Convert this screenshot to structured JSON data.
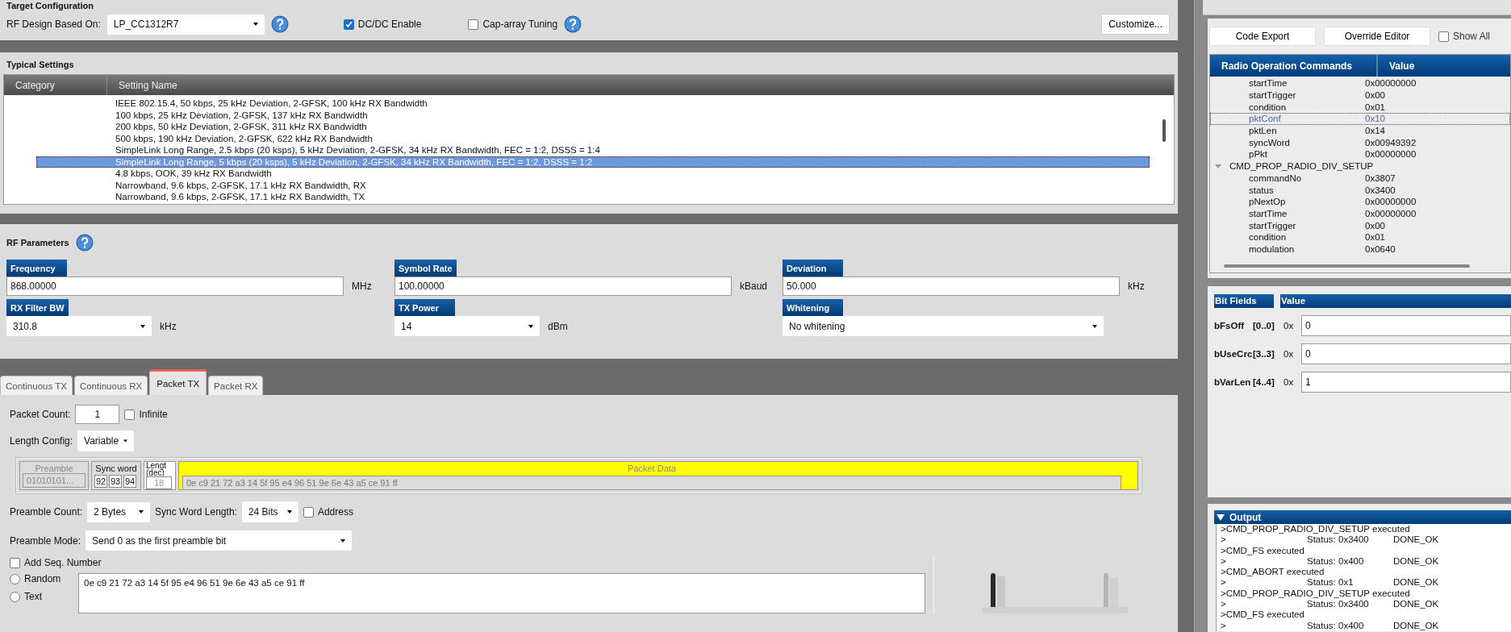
{
  "target_config": {
    "title": "Target Configuration",
    "rf_design_label": "RF Design Based On:",
    "rf_design_value": "LP_CC1312R7",
    "dcdc": {
      "label": "DC/DC Enable",
      "checked": true
    },
    "cap_array": {
      "label": "Cap-array Tuning",
      "checked": false
    },
    "customize_button": "Customize..."
  },
  "typical_settings": {
    "title": "Typical Settings",
    "columns": [
      "Category",
      "Setting Name"
    ],
    "rows": [
      {
        "name": "IEEE 802.15.4, 50 kbps, 25 kHz Deviation, 2-GFSK, 100 kHz RX Bandwidth",
        "selected": false
      },
      {
        "name": "100 kbps, 25 kHz Deviation, 2-GFSK, 137 kHz RX Bandwidth",
        "selected": false
      },
      {
        "name": "200 kbps, 50 kHz Deviation, 2-GFSK, 311 kHz RX Bandwidth",
        "selected": false
      },
      {
        "name": "500 kbps, 190 kHz Deviation, 2-GFSK, 622 kHz RX Bandwidth",
        "selected": false
      },
      {
        "name": "SimpleLink Long Range, 2.5 kbps (20 ksps), 5 kHz Deviation, 2-GFSK, 34 kHz RX Bandwidth, FEC = 1:2, DSSS = 1:4",
        "selected": false
      },
      {
        "name": "SimpleLink Long Range, 5 kbps (20 ksps), 5 kHz Deviation, 2-GFSK, 34 kHz RX Bandwidth, FEC = 1:2, DSSS = 1:2",
        "selected": true
      },
      {
        "name": "4.8 kbps, OOK, 39 kHz RX Bandwidth",
        "selected": false
      },
      {
        "name": "Narrowband, 9.6 kbps, 2-GFSK, 17.1 kHz RX Bandwidth, RX",
        "selected": false
      },
      {
        "name": "Narrowband, 9.6 kbps, 2-GFSK, 17.1 kHz RX Bandwidth, TX",
        "selected": false
      }
    ]
  },
  "rf_parameters": {
    "title": "RF Parameters",
    "fields": [
      {
        "label": "Frequency",
        "kind": "input",
        "value": "868.00000",
        "unit": "MHz"
      },
      {
        "label": "Symbol Rate",
        "kind": "input",
        "value": "100.00000",
        "unit": "kBaud"
      },
      {
        "label": "Deviation",
        "kind": "input",
        "value": "50.000",
        "unit": "kHz"
      },
      {
        "label": "RX Filter BW",
        "kind": "select",
        "value": "310.8",
        "unit": "kHz"
      },
      {
        "label": "TX Power",
        "kind": "select",
        "value": "14",
        "unit": "dBm"
      },
      {
        "label": "Whitening",
        "kind": "select",
        "value": "No whitening"
      }
    ]
  },
  "tabs": [
    {
      "label": "Continuous TX",
      "selected": false
    },
    {
      "label": "Continuous RX",
      "selected": false
    },
    {
      "label": "Packet TX",
      "selected": true
    },
    {
      "label": "Packet RX",
      "selected": false
    }
  ],
  "packet_tx": {
    "packet_count_label": "Packet Count:",
    "packet_count": "1",
    "infinite": {
      "label": "Infinite",
      "checked": false
    },
    "length_config_label": "Length Config:",
    "length_config": "Variable",
    "structure": {
      "preamble_label": "Preamble",
      "preamble": "01010101...",
      "sync_label": "Sync word",
      "sync_bytes": [
        "92",
        "93",
        "94"
      ],
      "length_label": "Lengt (dec)",
      "length": "18",
      "data_label": "Packet Data",
      "data": "0e c9 21 72 a3 14 5f 95 e4 96 51 9e 6e 43 a5 ce 91 ff"
    },
    "preamble_count_label": "Preamble Count:",
    "preamble_count": "2 Bytes",
    "sync_length_label": "Sync Word Length:",
    "sync_length": "24 Bits",
    "address": {
      "label": "Address",
      "checked": false
    },
    "preamble_mode_label": "Preamble Mode:",
    "preamble_mode": "Send 0 as the first preamble bit",
    "seq_number": {
      "label": "Add Seq. Number",
      "checked": false
    },
    "payload_options": [
      {
        "label": "Random",
        "selected": false
      },
      {
        "label": "Text",
        "selected": false
      }
    ],
    "payload": "0e c9 21 72 a3 14 5f 95 e4 96 51 9e 6e 43 a5 ce 91 ff"
  },
  "right_panel": {
    "buttons": [
      "Code Export",
      "Override Editor"
    ],
    "show_all": {
      "label": "Show All",
      "checked": false
    },
    "commands": {
      "columns": [
        "Radio Operation Commands",
        "Value"
      ],
      "tree": [
        {
          "children": [
            {
              "name": "startTime",
              "value": "0x00000000",
              "selected": false
            },
            {
              "name": "startTrigger",
              "value": "0x00",
              "selected": false
            },
            {
              "name": "condition",
              "value": "0x01",
              "selected": false
            },
            {
              "name": "pktConf",
              "value": "0x10",
              "selected": true
            },
            {
              "name": "pktLen",
              "value": "0x14",
              "selected": false
            },
            {
              "name": "syncWord",
              "value": "0x00949392",
              "selected": false
            },
            {
              "name": "pPkt",
              "value": "0x00000000",
              "selected": false
            }
          ]
        },
        {
          "name": "CMD_PROP_RADIO_DIV_SETUP",
          "expanded": true,
          "selected": false,
          "children": [
            {
              "name": "commandNo",
              "value": "0x3807",
              "selected": false
            },
            {
              "name": "status",
              "value": "0x3400",
              "selected": false
            },
            {
              "name": "pNextOp",
              "value": "0x00000000",
              "selected": false
            },
            {
              "name": "startTime",
              "value": "0x00000000",
              "selected": false
            },
            {
              "name": "startTrigger",
              "value": "0x00",
              "selected": false
            },
            {
              "name": "condition",
              "value": "0x01",
              "selected": false
            },
            {
              "name": "modulation",
              "value": "0x0640",
              "selected": false
            }
          ]
        }
      ]
    },
    "bit_fields": {
      "columns": [
        "Bit Fields",
        "Value"
      ],
      "rows": [
        {
          "name": "bFsOff",
          "range": "[0..0]",
          "prefix": "0x",
          "value": "0"
        },
        {
          "name": "bUseCrc",
          "range": "[3..3]",
          "prefix": "0x",
          "value": "0"
        },
        {
          "name": "bVarLen",
          "range": "[4..4]",
          "prefix": "0x",
          "value": "1"
        }
      ]
    },
    "output": {
      "title": "Output",
      "expanded": true,
      "lines": [
        {
          "kind": "command",
          "text": ">CMD_PROP_RADIO_DIV_SETUP executed"
        },
        {
          "kind": "status",
          "prompt": ">",
          "status": "Status: 0x3400",
          "result": "DONE_OK"
        },
        {
          "kind": "command",
          "text": ">CMD_FS executed"
        },
        {
          "kind": "status",
          "prompt": ">",
          "status": "Status: 0x400",
          "result": "DONE_OK"
        },
        {
          "kind": "command",
          "text": ">CMD_ABORT executed"
        },
        {
          "kind": "status",
          "prompt": ">",
          "status": "Status: 0x1",
          "result": "DONE_OK"
        },
        {
          "kind": "command",
          "text": ">CMD_PROP_RADIO_DIV_SETUP executed"
        },
        {
          "kind": "status",
          "prompt": ">",
          "status": "Status: 0x3400",
          "result": "DONE_OK"
        },
        {
          "kind": "command",
          "text": ">CMD_FS executed"
        },
        {
          "kind": "status",
          "prompt": ">",
          "status": "Status: 0x400",
          "result": "DONE_OK"
        }
      ]
    }
  }
}
